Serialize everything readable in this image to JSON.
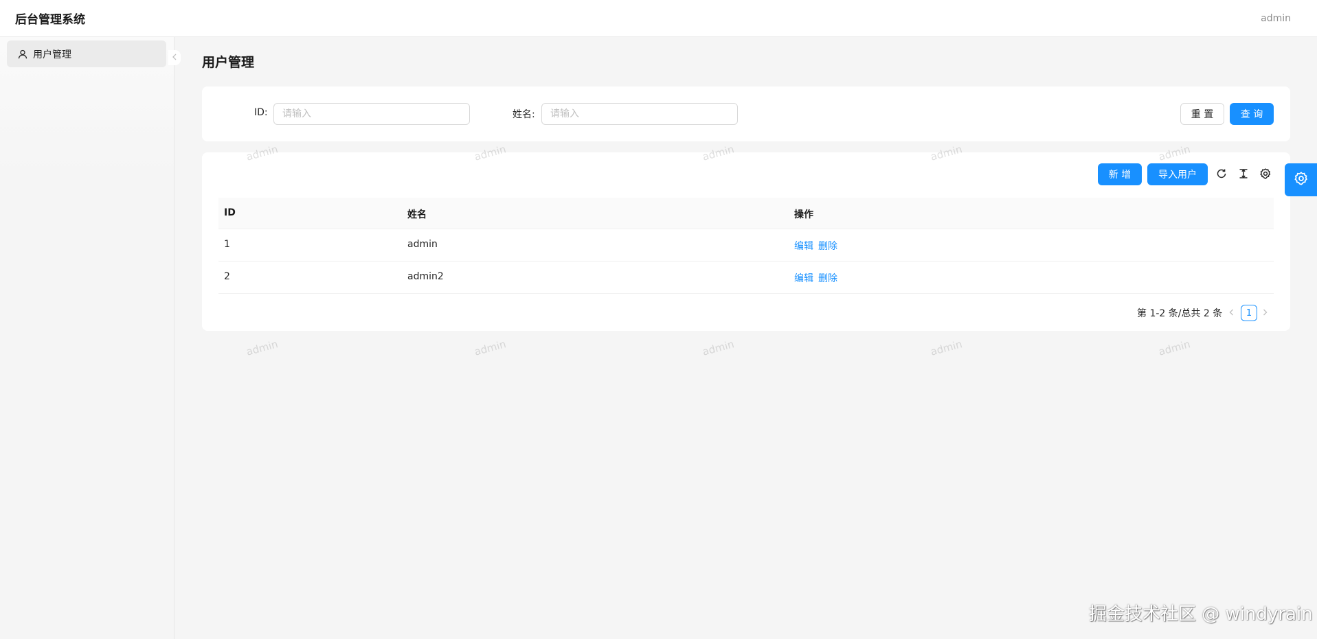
{
  "header": {
    "app_title": "后台管理系统",
    "user": "admin"
  },
  "sidebar": {
    "items": [
      {
        "label": "用户管理",
        "icon": "user-icon",
        "active": true
      }
    ]
  },
  "main": {
    "page_title": "用户管理"
  },
  "search": {
    "fields": [
      {
        "label": "ID",
        "placeholder": "请输入",
        "value": ""
      },
      {
        "label": "姓名",
        "placeholder": "请输入",
        "value": ""
      }
    ],
    "reset_label": "重 置",
    "query_label": "查 询"
  },
  "toolbar": {
    "add_label": "新 增",
    "import_label": "导入用户",
    "icons": [
      "reload-icon",
      "column-height-icon",
      "setting-icon"
    ]
  },
  "table": {
    "columns": [
      "ID",
      "姓名",
      "操作"
    ],
    "rows": [
      {
        "id": "1",
        "name": "admin",
        "actions": [
          "编辑",
          "删除"
        ]
      },
      {
        "id": "2",
        "name": "admin2",
        "actions": [
          "编辑",
          "删除"
        ]
      }
    ]
  },
  "pagination": {
    "summary": "第 1-2 条/总共 2 条",
    "current": "1"
  },
  "watermark_text": "admin",
  "site_watermark": "掘金技术社区 @ windyrain",
  "colors": {
    "primary": "#1890ff",
    "background": "#f5f5f5"
  }
}
